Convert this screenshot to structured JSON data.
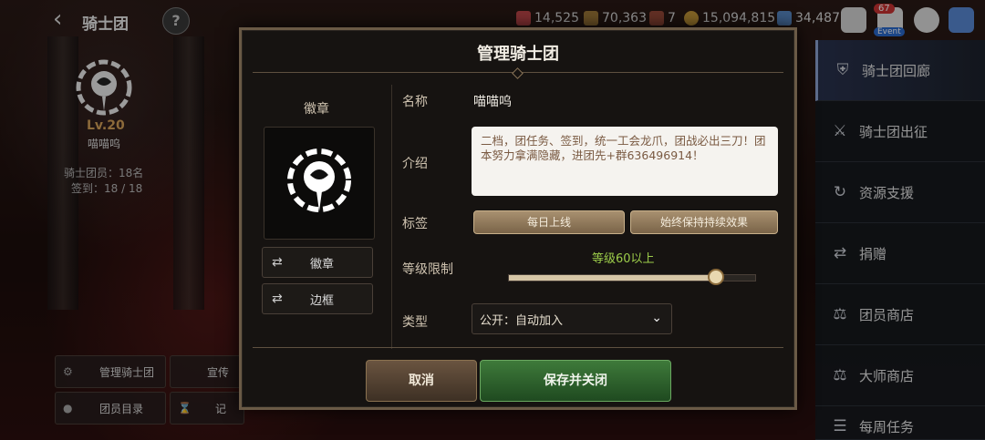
{
  "header": {
    "back_icon": "chevron-left-icon",
    "title": "骑士团",
    "help": "?",
    "resources": [
      {
        "icon": "crystal-icon",
        "value": "14,525",
        "color": "#c0484a"
      },
      {
        "icon": "chest-icon",
        "value": "70,363",
        "color": "#a07a3a"
      },
      {
        "icon": "scroll-icon",
        "value": "7",
        "color": "#9a4a3a"
      },
      {
        "icon": "gold-coin-icon",
        "value": "15,094,815",
        "color": "#c89a3a"
      },
      {
        "icon": "gem-icon",
        "value": "34,487",
        "color": "#5a8ac8"
      }
    ],
    "mail_badge": "67",
    "event_label": "Event"
  },
  "guild_panel": {
    "level": "Lv.20",
    "name": "喵喵呜",
    "members": "骑士团员：18名",
    "checkin": "签到：18 / 18",
    "buttons": [
      "管理骑士团",
      "宣传",
      "团员目录",
      "记"
    ]
  },
  "sidebar": {
    "items": [
      {
        "label": "骑士团回廊",
        "icon": "shield-icon"
      },
      {
        "label": "骑士团出征",
        "icon": "crossed-swords-icon"
      },
      {
        "label": "资源支援",
        "icon": "support-icon"
      },
      {
        "label": "捐赠",
        "icon": "shuffle-icon"
      },
      {
        "label": "团员商店",
        "icon": "scale-icon"
      },
      {
        "label": "大师商店",
        "icon": "scale-icon"
      },
      {
        "label": "每周任务",
        "icon": "book-icon"
      }
    ]
  },
  "dialog": {
    "title": "管理骑士团",
    "emblem_label": "徽章",
    "emblem_button": "徽章",
    "frame_button": "边框",
    "name_label": "名称",
    "name_value": "喵喵呜",
    "intro_label": "介绍",
    "intro_text": "二档，团任务、签到，统一工会龙爪，团战必出三刀！团本努力拿满隐藏，进团先+群636496914！",
    "tags_label": "标签",
    "tags": [
      "每日上线",
      "始终保持持续效果"
    ],
    "level_label": "等级限制",
    "level_value": "等级60以上",
    "level_fraction": 0.84,
    "type_label": "类型",
    "type_value": "公开：自动加入",
    "cancel": "取消",
    "save": "保存并关闭"
  }
}
